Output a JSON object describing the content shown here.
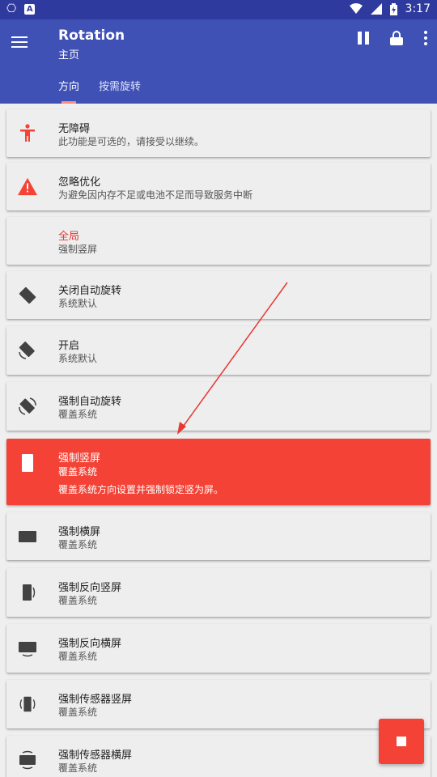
{
  "statusbar": {
    "time": "3:17",
    "left_glyph": "⎔",
    "left_badge": "A",
    "icons": [
      "wifi-icon",
      "signal-icon",
      "battery-icon"
    ]
  },
  "appbar": {
    "title": "Rotation",
    "subtitle": "主页"
  },
  "tabs": [
    {
      "label": "方向",
      "active": true
    },
    {
      "label": "按需旋转",
      "active": false
    }
  ],
  "items": [
    {
      "icon": "accessibility-icon",
      "title": "无障碍",
      "subtitle": "此功能是可选的，请接受以继续。"
    },
    {
      "icon": "warning-icon",
      "title": "忽略优化",
      "subtitle": "为避免因内存不足或电池不足而导致服务中断"
    },
    {
      "icon": "",
      "title": "全局",
      "subtitle": "强制竖屏"
    },
    {
      "icon": "rotate-off-icon",
      "title": "关闭自动旋转",
      "subtitle": "系统默认"
    },
    {
      "icon": "rotate-on-icon",
      "title": "开启",
      "subtitle": "系统默认"
    },
    {
      "icon": "force-auto-rotate-icon",
      "title": "强制自动旋转",
      "subtitle": "覆盖系统"
    },
    {
      "icon": "portrait-icon",
      "title": "强制竖屏",
      "subtitle": "覆盖系统",
      "detail": "覆盖系统方向设置并强制锁定竖为屏。"
    },
    {
      "icon": "landscape-icon",
      "title": "强制横屏",
      "subtitle": "覆盖系统"
    },
    {
      "icon": "reverse-portrait-icon",
      "title": "强制反向竖屏",
      "subtitle": "覆盖系统"
    },
    {
      "icon": "reverse-landscape-icon",
      "title": "强制反向横屏",
      "subtitle": "覆盖系统"
    },
    {
      "icon": "sensor-portrait-icon",
      "title": "强制传感器竖屏",
      "subtitle": "覆盖系统"
    },
    {
      "icon": "sensor-landscape-icon",
      "title": "强制传感器横屏",
      "subtitle": "覆盖系统"
    }
  ],
  "colors": {
    "primary": "#3f51b5",
    "primary_dark": "#2f3a9e",
    "accent": "#f44336"
  }
}
